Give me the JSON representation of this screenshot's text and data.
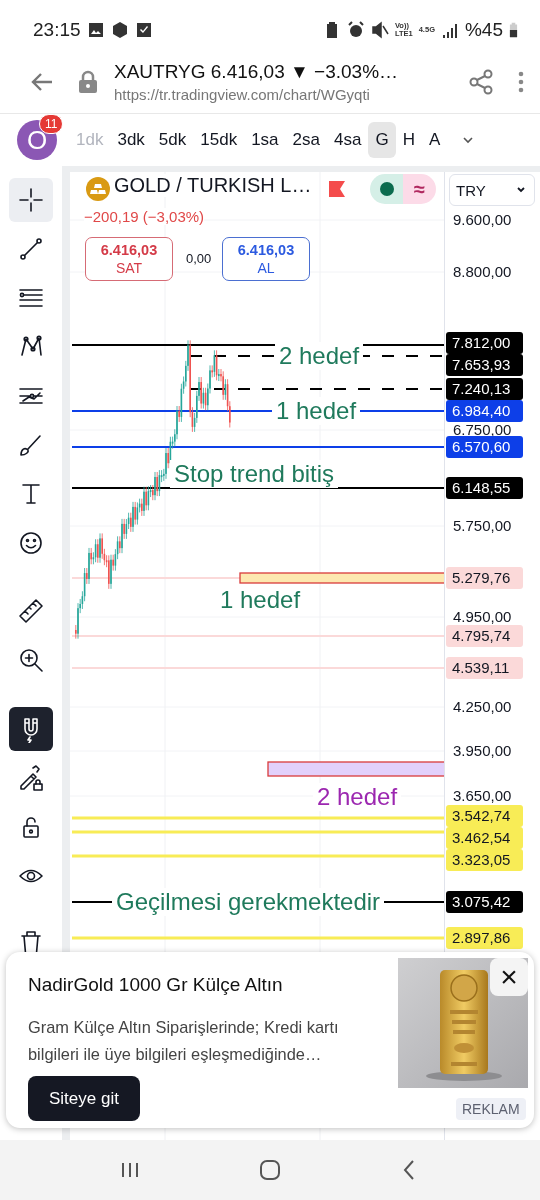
{
  "status_bar": {
    "time": "23:15",
    "volte": "Vo))",
    "lte": "LTE1",
    "net": "4.5G",
    "battery": "%45"
  },
  "browser": {
    "title": "XAUTRYG 6.416,03 ▼ −3.03%…",
    "url": "https://tr.tradingview.com/chart/WGyqti"
  },
  "interval_bar": {
    "avatar": "O",
    "badge": "11",
    "intervals": [
      {
        "label": "1dk",
        "selected": false,
        "disabled": true
      },
      {
        "label": "3dk",
        "selected": false,
        "disabled": false
      },
      {
        "label": "5dk",
        "selected": false,
        "disabled": false
      },
      {
        "label": "15dk",
        "selected": false,
        "disabled": false
      },
      {
        "label": "1sa",
        "selected": false,
        "disabled": false
      },
      {
        "label": "2sa",
        "selected": false,
        "disabled": false
      },
      {
        "label": "4sa",
        "selected": false,
        "disabled": false
      },
      {
        "label": "G",
        "selected": true,
        "disabled": false
      },
      {
        "label": "H",
        "selected": false,
        "disabled": false
      },
      {
        "label": "A",
        "selected": false,
        "disabled": false
      }
    ]
  },
  "tools": [
    {
      "kind": "crosshair",
      "selected": true,
      "on": false
    },
    {
      "kind": "trend-line",
      "selected": false,
      "on": false
    },
    {
      "kind": "fib",
      "selected": false,
      "on": false
    },
    {
      "kind": "pattern",
      "selected": false,
      "on": false
    },
    {
      "kind": "prediction",
      "selected": false,
      "on": false
    },
    {
      "kind": "brush",
      "selected": false,
      "on": false
    },
    {
      "kind": "text",
      "selected": false,
      "on": false
    },
    {
      "kind": "smiley",
      "selected": false,
      "on": false
    },
    {
      "kind": "ruler",
      "selected": false,
      "on": false
    },
    {
      "kind": "zoom",
      "selected": false,
      "on": false
    },
    {
      "kind": "magnet",
      "selected": false,
      "on": true
    },
    {
      "kind": "pencil-lock",
      "selected": false,
      "on": false
    },
    {
      "kind": "lock",
      "selected": false,
      "on": false
    },
    {
      "kind": "eye",
      "selected": false,
      "on": false
    },
    {
      "kind": "trash",
      "selected": false,
      "on": false
    }
  ],
  "chart": {
    "symbol": "GOLD / TURKISH L…",
    "status_symbol": "≈",
    "change": "−200,19 (−3,03%)",
    "sell": {
      "price": "6.416,03",
      "label": "SAT"
    },
    "spread": "0,00",
    "buy": {
      "price": "6.416,03",
      "label": "AL"
    },
    "currency": "TRY",
    "price_axis": [
      {
        "text": "9.600,00",
        "kind": "tick"
      },
      {
        "text": "8.800,00",
        "kind": "tick"
      },
      {
        "text": "7.812,00",
        "kind": "solid",
        "color": "#000000"
      },
      {
        "text": "7.653,93",
        "kind": "dashed",
        "color": "#000000"
      },
      {
        "text": "7.240,13",
        "kind": "dashed",
        "color": "#000000"
      },
      {
        "text": "6.984,40",
        "kind": "solid",
        "color": "#0d3fe8"
      },
      {
        "text": "6.750,00",
        "kind": "tick"
      },
      {
        "text": "6.570,60",
        "kind": "solid",
        "color": "#0d3fe8"
      },
      {
        "text": "6.148,55",
        "kind": "solid",
        "color": "#000000"
      },
      {
        "text": "5.750,00",
        "kind": "tick"
      },
      {
        "text": "5.279,76",
        "kind": "thin",
        "color": "#fbd9d9"
      },
      {
        "text": "4.950,00",
        "kind": "tick"
      },
      {
        "text": "4.795,74",
        "kind": "thin",
        "color": "#fbd9d9"
      },
      {
        "text": "4.539,11",
        "kind": "thin",
        "color": "#fbd9d9"
      },
      {
        "text": "4.250,00",
        "kind": "tick"
      },
      {
        "text": "3.950,00",
        "kind": "tick"
      },
      {
        "text": "3.650,00",
        "kind": "tick"
      },
      {
        "text": "3.542,74",
        "kind": "thick",
        "color": "#f8ec56"
      },
      {
        "text": "3.462,54",
        "kind": "thick",
        "color": "#f8ec56"
      },
      {
        "text": "3.323,05",
        "kind": "thick",
        "color": "#f8ec56"
      },
      {
        "text": "3.075,42",
        "kind": "solid",
        "color": "#000000"
      },
      {
        "text": "2.897,86",
        "kind": "thick",
        "color": "#f8ec56"
      }
    ],
    "zones": [
      {
        "color": "#fde8b0"
      },
      {
        "color": "#e2d0fb"
      }
    ],
    "annotations": [
      {
        "text": "2 hedef",
        "color": "#1f7a5c"
      },
      {
        "text": "1 hedef",
        "color": "#1f7a5c"
      },
      {
        "text": "Stop trend bitiş",
        "color": "#1f7a5c"
      },
      {
        "text": "1 hedef",
        "color": "#1f7a5c"
      },
      {
        "text": "2 hedef",
        "color": "#9c27b0"
      },
      {
        "text": "Geçilmesi gerekmektedir",
        "color": "#1f7a5c"
      }
    ]
  },
  "ad": {
    "title": "NadirGold 1000 Gr Külçe Altın",
    "description": "Gram Külçe Altın Siparişlerinde; Kredi kartı bilgileri ile üye bilgileri eşleşmediğinde…",
    "button": "Siteye git",
    "close": "×",
    "label": "REKLAM"
  }
}
